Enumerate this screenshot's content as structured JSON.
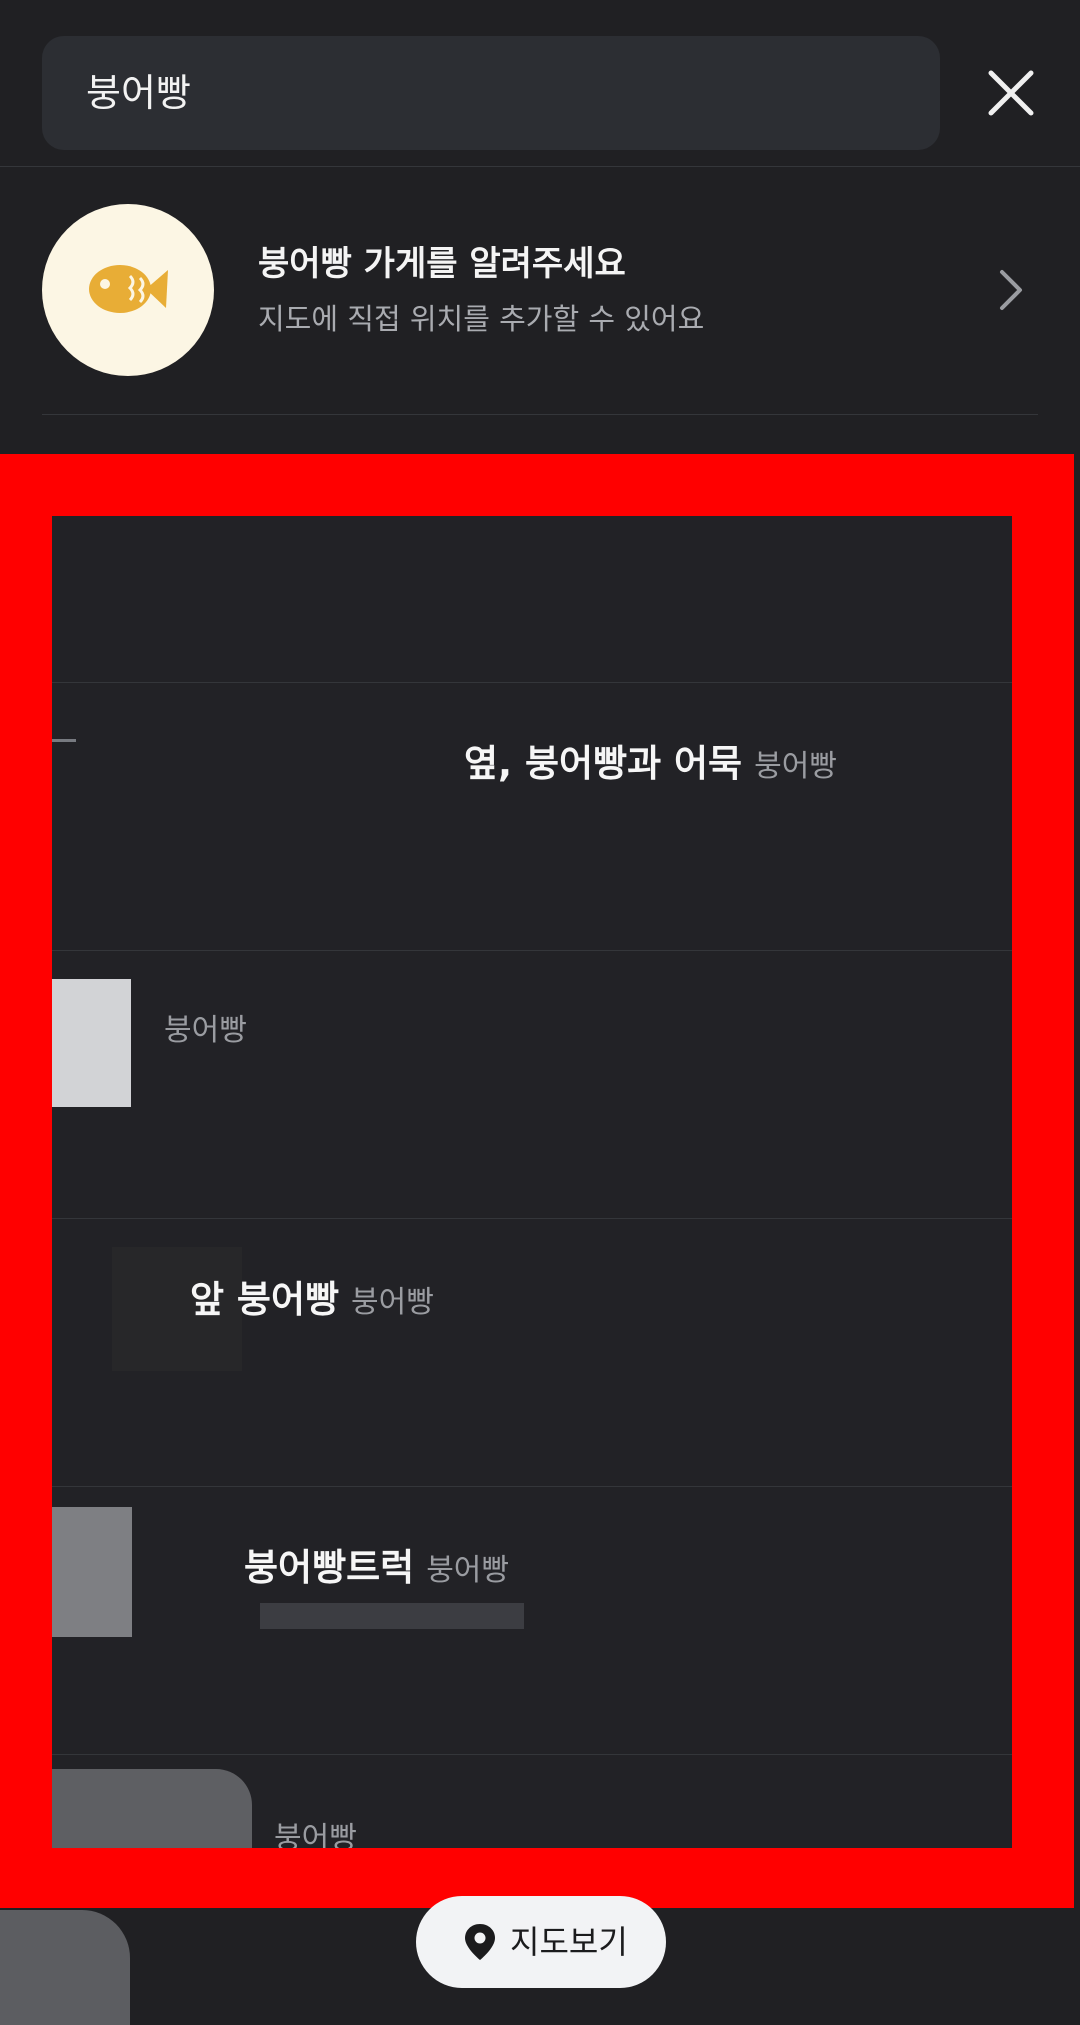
{
  "search": {
    "query": "붕어빵"
  },
  "banner": {
    "title": "붕어빵 가게를 알려주세요",
    "subtitle": "지도에 직접 위치를 추가할 수 있어요"
  },
  "results": [
    {
      "name": "",
      "category": ""
    },
    {
      "name": "옆, 붕어빵과 어묵",
      "category": "붕어빵"
    },
    {
      "name": "",
      "category": "붕어빵"
    },
    {
      "name": "앞 붕어빵",
      "category": "붕어빵"
    },
    {
      "name": "붕어빵트럭",
      "category": "붕어빵"
    },
    {
      "name": "",
      "category": "붕어빵"
    }
  ],
  "map_button": {
    "label": "지도보기"
  },
  "icons": {
    "close": "close-icon",
    "fish": "fish-icon",
    "chevron": "chevron-right-icon",
    "pin": "map-pin-icon"
  },
  "colors": {
    "background": "#202023",
    "highlight": "#ff0000",
    "fish_accent": "#e8ad36"
  }
}
